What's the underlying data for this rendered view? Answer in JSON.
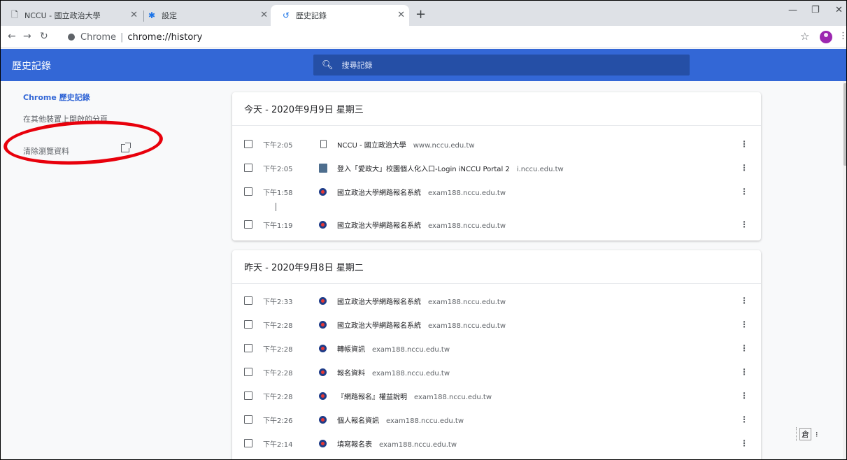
{
  "tabs": [
    {
      "title": "NCCU - 國立政治大學",
      "icon": "document-icon"
    },
    {
      "title": "設定",
      "icon": "gear-icon"
    },
    {
      "title": "歷史記錄",
      "icon": "history-icon"
    }
  ],
  "toolbar": {
    "site_label": "Chrome",
    "url": "chrome://history"
  },
  "header": {
    "title": "歷史記錄",
    "search_placeholder": "搜尋記錄"
  },
  "sidebar": {
    "items": [
      {
        "label": "Chrome 歷史記錄"
      },
      {
        "label": "在其他裝置上開啟的分頁"
      },
      {
        "label": "清除瀏覽資料"
      }
    ]
  },
  "cards": [
    {
      "title": "今天 - 2020年9月9日 星期三",
      "rows": [
        {
          "time": "下午2:05",
          "title": "NCCU - 國立政治大學",
          "domain": "www.nccu.edu.tw",
          "icon": "document-icon"
        },
        {
          "time": "下午2:05",
          "title": "登入「愛政大」校園個人化入口-Login iNCCU Portal 2",
          "domain": "i.nccu.edu.tw",
          "icon": "inccu-portal-icon"
        },
        {
          "time": "下午1:58",
          "title": "國立政治大學網路報名系統",
          "domain": "exam188.nccu.edu.tw",
          "icon": "nccu-icon"
        },
        {
          "time": "下午1:19",
          "title": "國立政治大學網路報名系統",
          "domain": "exam188.nccu.edu.tw",
          "icon": "nccu-icon"
        }
      ]
    },
    {
      "title": "昨天 - 2020年9月8日 星期二",
      "rows": [
        {
          "time": "下午2:33",
          "title": "國立政治大學網路報名系統",
          "domain": "exam188.nccu.edu.tw",
          "icon": "nccu-icon"
        },
        {
          "time": "下午2:28",
          "title": "國立政治大學網路報名系統",
          "domain": "exam188.nccu.edu.tw",
          "icon": "nccu-icon"
        },
        {
          "time": "下午2:28",
          "title": "轉帳資訊",
          "domain": "exam188.nccu.edu.tw",
          "icon": "nccu-icon"
        },
        {
          "time": "下午2:28",
          "title": "報名資料",
          "domain": "exam188.nccu.edu.tw",
          "icon": "nccu-icon"
        },
        {
          "time": "下午2:28",
          "title": "『網路報名』權益說明",
          "domain": "exam188.nccu.edu.tw",
          "icon": "nccu-icon"
        },
        {
          "time": "下午2:26",
          "title": "個人報名資訊",
          "domain": "exam188.nccu.edu.tw",
          "icon": "nccu-icon"
        },
        {
          "time": "下午2:14",
          "title": "填寫報名表",
          "domain": "exam188.nccu.edu.tw",
          "icon": "nccu-icon"
        }
      ]
    }
  ],
  "ime": {
    "label": "倉"
  },
  "colors": {
    "header": "#3367d6",
    "annotation": "#e8000b"
  }
}
